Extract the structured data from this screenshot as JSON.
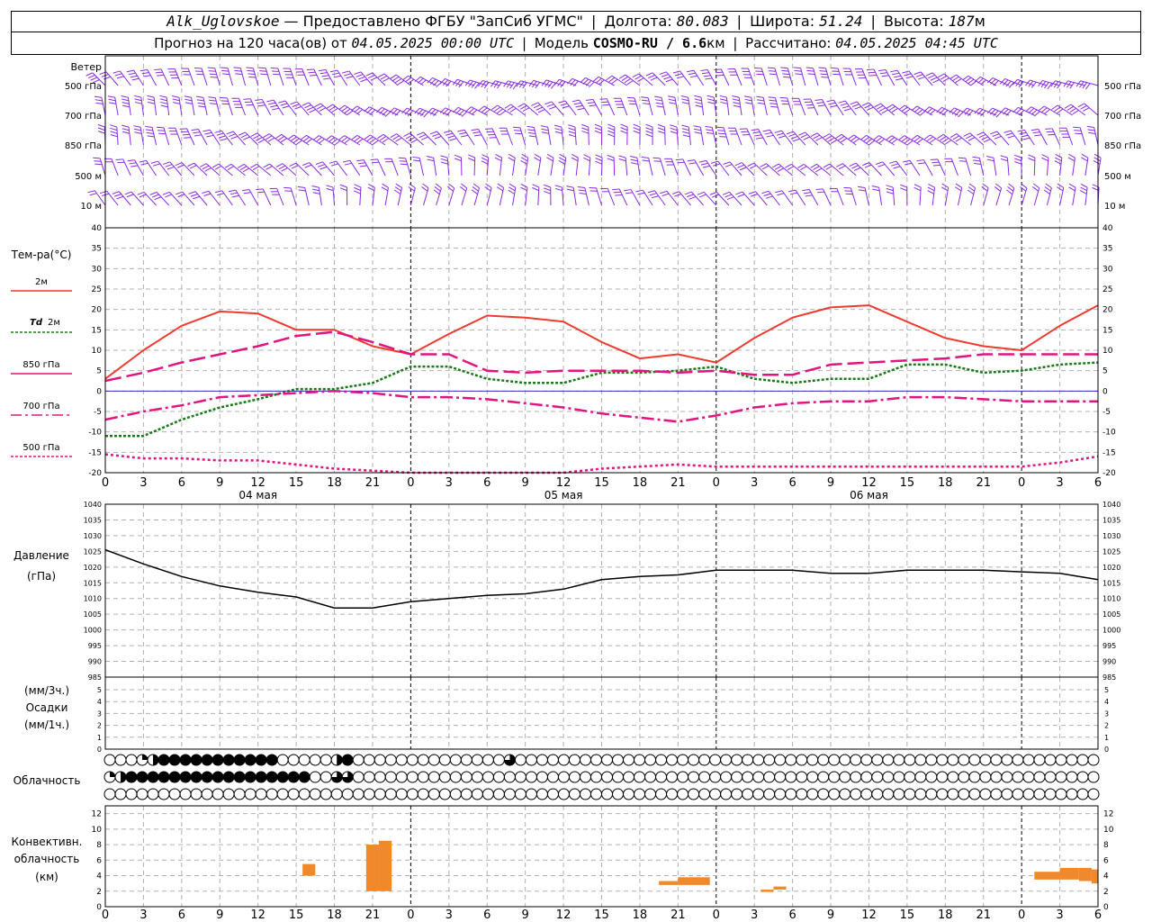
{
  "header": {
    "station": "Alk_Uglovskoe",
    "provider": "— Предоставлено ФГБУ \"ЗапСиб УГМС\"",
    "lon_label": "Долгота:",
    "lon_value": "80.083",
    "lat_label": "Широта:",
    "lat_value": "51.24",
    "alt_label": "Высота:",
    "alt_value": "187",
    "alt_unit": "м",
    "forecast_label": "Прогноз на 120 часа(ов) от",
    "forecast_time": "04.05.2025 00:00 UTC",
    "model_label": "Модель",
    "model_value": "COSMO-RU / 6.6",
    "model_unit": "км",
    "calc_label": "Рассчитано:",
    "calc_time": "04.05.2025 04:45 UTC"
  },
  "labels": {
    "wind": "Ветер",
    "wind_levels": [
      "500 гПа",
      "700 гПа",
      "850 гПа",
      "500 м",
      "10  м"
    ],
    "temp_title": "Тем-ра(°C)",
    "legend_2m": "2м",
    "legend_td": "Td",
    "legend_td_suffix": "2м",
    "legend_850": "850 гПа",
    "legend_700": "700 гПа",
    "legend_500": "500 гПа",
    "pressure_title": "Давление",
    "pressure_unit": "(гПа)",
    "precip_unit1": "(мм/3ч.)",
    "precip_title": "Осадки",
    "precip_unit2": "(мм/1ч.)",
    "clouds_title": "Облачность",
    "conv_title1": "Конвективн.",
    "conv_title2": "облачность",
    "conv_unit": "(км)"
  },
  "colors": {
    "t2m": "#ee3b2f",
    "td": "#1a7a1a",
    "t850": "#e0157e",
    "t700": "#e0157e",
    "t500": "#e0157e",
    "wind": "#8a2be2",
    "conv": "#f0892c",
    "zero": "#3030c0"
  },
  "chart_data": [
    {
      "type": "line",
      "title": "Тем-ра(°C)",
      "x_hours": [
        0,
        3,
        6,
        9,
        12,
        15,
        18,
        21,
        24,
        27,
        30,
        33,
        36,
        39,
        42,
        45,
        48,
        51,
        54,
        57,
        60,
        63,
        66,
        69,
        72,
        75,
        78
      ],
      "x_tick_labels": [
        "0",
        "3",
        "6",
        "9",
        "12",
        "15",
        "18",
        "21",
        "0",
        "3",
        "6",
        "9",
        "12",
        "15",
        "18",
        "21",
        "0",
        "3",
        "6",
        "9",
        "12",
        "15",
        "18",
        "21",
        "0",
        "3",
        "6"
      ],
      "day_labels": [
        "04 мая",
        "05 мая",
        "06 мая"
      ],
      "ylim": [
        -20,
        40
      ],
      "series": [
        {
          "name": "2м",
          "values": [
            3,
            10,
            16,
            19.5,
            19,
            15,
            15,
            11,
            9,
            14,
            18.5,
            18,
            17,
            12,
            8,
            9,
            7,
            13,
            18,
            20.5,
            21,
            17,
            13,
            11,
            10,
            16,
            21
          ]
        },
        {
          "name": "Td 2м",
          "values": [
            -11,
            -11,
            -7,
            -4,
            -2,
            0.5,
            0.5,
            2,
            6,
            6,
            3,
            2,
            2,
            4.5,
            4.5,
            5,
            6,
            3,
            2,
            3,
            3,
            6.5,
            6.5,
            4.5,
            5,
            6.5,
            7
          ]
        },
        {
          "name": "850 гПа",
          "values": [
            2.5,
            4.5,
            7,
            9,
            11,
            13.5,
            14.5,
            12,
            9,
            9,
            5,
            4.5,
            5,
            5,
            5,
            4.5,
            5,
            4,
            4,
            6.5,
            7,
            7.5,
            8,
            9,
            9,
            9,
            9
          ]
        },
        {
          "name": "700 гПа",
          "values": [
            -7,
            -5,
            -3.5,
            -1.5,
            -1,
            -0.5,
            0,
            -0.5,
            -1.5,
            -1.5,
            -2,
            -3,
            -4,
            -5.5,
            -6.5,
            -7.5,
            -6,
            -4,
            -3,
            -2.5,
            -2.5,
            -1.5,
            -1.5,
            -2,
            -2.5,
            -2.5,
            -2.5
          ]
        },
        {
          "name": "500 гПа",
          "values": [
            -15.5,
            -16.5,
            -16.5,
            -17,
            -17,
            -18,
            -19,
            -19.5,
            -20,
            -20,
            -20,
            -20,
            -20,
            -19,
            -18.5,
            -18,
            -18.5,
            -18.5,
            -18.5,
            -18.5,
            -18.5,
            -18.5,
            -18.5,
            -18.5,
            -18.5,
            -17.5,
            -16
          ]
        }
      ]
    },
    {
      "type": "line",
      "title": "Давление",
      "ylim": [
        985,
        1040
      ],
      "series": [
        {
          "name": "Давление",
          "values": [
            1025.5,
            1021,
            1017,
            1014,
            1012,
            1010.5,
            1007,
            1007,
            1009,
            1010,
            1011,
            1011.5,
            1013,
            1016,
            1017,
            1017.5,
            1019,
            1019,
            1019,
            1018,
            1018,
            1019,
            1019,
            1019,
            1018.5,
            1018,
            1016
          ]
        }
      ]
    },
    {
      "type": "bar",
      "title": "Осадки",
      "ylim": [
        0,
        5
      ],
      "values": []
    },
    {
      "type": "bar",
      "title": "Конвективн. облачность",
      "ylim": [
        0,
        13
      ],
      "bars": [
        {
          "x0": 15.5,
          "x1": 16.5,
          "base": 4,
          "top": 5.5
        },
        {
          "x0": 20.5,
          "x1": 21.5,
          "base": 2,
          "top": 8
        },
        {
          "x0": 21.5,
          "x1": 22.5,
          "base": 2,
          "top": 8.5
        },
        {
          "x0": 43.5,
          "x1": 45.0,
          "base": 2.8,
          "top": 3.3
        },
        {
          "x0": 45.0,
          "x1": 47.5,
          "base": 2.8,
          "top": 3.8
        },
        {
          "x0": 51.5,
          "x1": 52.5,
          "base": 1.9,
          "top": 2.2
        },
        {
          "x0": 52.5,
          "x1": 53.5,
          "base": 2.2,
          "top": 2.6
        },
        {
          "x0": 73.0,
          "x1": 75.0,
          "base": 3.5,
          "top": 4.5
        },
        {
          "x0": 75.0,
          "x1": 76.5,
          "base": 3.5,
          "top": 5.0
        },
        {
          "x0": 76.5,
          "x1": 77.5,
          "base": 3.3,
          "top": 5.0
        },
        {
          "x0": 77.5,
          "x1": 78.0,
          "base": 3.0,
          "top": 4.8
        }
      ]
    }
  ],
  "cloud_cover": {
    "rows": [
      {
        "name": "high",
        "levels": [
          0,
          0,
          0,
          1,
          2,
          4,
          4,
          4,
          4,
          4,
          4,
          4,
          4,
          4,
          4,
          4,
          0,
          0,
          0,
          0,
          0,
          2,
          4,
          0,
          0,
          0,
          0,
          0,
          0,
          0,
          0,
          0,
          0,
          0,
          0,
          0,
          0,
          3,
          0,
          0,
          0,
          0,
          0,
          0,
          0,
          0,
          0,
          0,
          0,
          0,
          0,
          0,
          0,
          0,
          0,
          0,
          0,
          0,
          0,
          0,
          0,
          0,
          0,
          0,
          0,
          0,
          0,
          0,
          0,
          0,
          0,
          0,
          0,
          0,
          0,
          0,
          0,
          0,
          0,
          0,
          0,
          0,
          0,
          0,
          0,
          0,
          0,
          0,
          0,
          0,
          0,
          0
        ]
      },
      {
        "name": "mid",
        "levels": [
          1,
          2,
          4,
          4,
          4,
          4,
          4,
          4,
          4,
          4,
          4,
          4,
          4,
          4,
          4,
          4,
          4,
          4,
          4,
          0,
          0,
          3,
          3,
          0,
          0,
          0,
          0,
          0,
          0,
          0,
          0,
          0,
          0,
          0,
          0,
          0,
          0,
          0,
          0,
          0,
          0,
          0,
          0,
          0,
          0,
          0,
          0,
          0,
          0,
          0,
          0,
          0,
          0,
          0,
          0,
          0,
          0,
          0,
          0,
          0,
          0,
          0,
          0,
          0,
          0,
          0,
          0,
          0,
          0,
          0,
          0,
          0,
          0,
          0,
          0,
          0,
          0,
          0,
          0,
          0,
          0,
          0,
          0,
          0,
          0,
          0,
          0,
          0,
          0,
          0,
          0,
          0
        ]
      },
      {
        "name": "low",
        "levels": [
          0,
          0,
          0,
          0,
          0,
          0,
          0,
          0,
          0,
          0,
          0,
          0,
          0,
          0,
          0,
          0,
          0,
          0,
          0,
          0,
          0,
          0,
          0,
          0,
          0,
          0,
          0,
          0,
          0,
          0,
          0,
          0,
          0,
          0,
          0,
          0,
          0,
          0,
          0,
          0,
          0,
          0,
          0,
          0,
          0,
          0,
          0,
          0,
          0,
          0,
          0,
          0,
          0,
          0,
          0,
          0,
          0,
          0,
          0,
          0,
          0,
          0,
          0,
          0,
          0,
          0,
          0,
          0,
          0,
          0,
          0,
          0,
          0,
          0,
          0,
          0,
          0,
          0,
          0,
          0,
          0,
          0,
          0,
          0,
          0,
          0,
          0,
          0,
          0,
          0,
          0,
          0
        ]
      }
    ]
  }
}
